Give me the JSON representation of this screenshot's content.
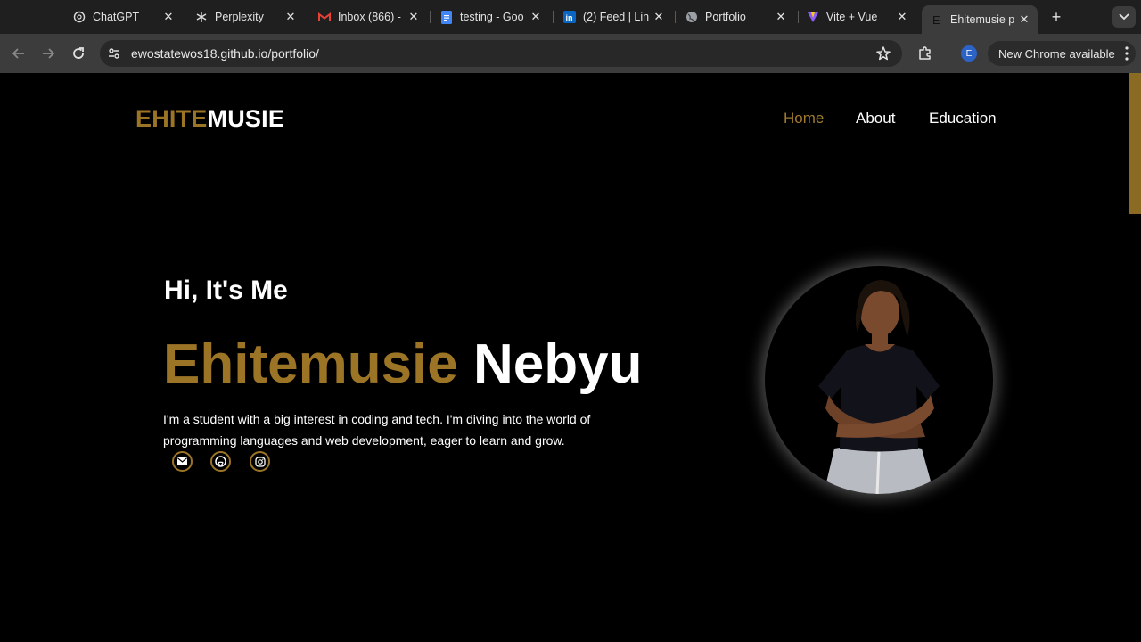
{
  "browser": {
    "tabs": [
      {
        "title": "ChatGPT",
        "icon": "chatgpt-icon"
      },
      {
        "title": "Perplexity",
        "icon": "perplexity-icon"
      },
      {
        "title": "Inbox (866) -",
        "icon": "gmail-icon"
      },
      {
        "title": "testing - Goo",
        "icon": "google-docs-icon"
      },
      {
        "title": "(2) Feed | Lin",
        "icon": "linkedin-icon"
      },
      {
        "title": "Portfolio",
        "icon": "globe-icon"
      },
      {
        "title": "Vite + Vue",
        "icon": "vite-icon"
      },
      {
        "title": "Ehitemusie p",
        "icon": "site-favicon-icon",
        "active": true
      }
    ],
    "url": "ewostatewos18.github.io/portfolio/",
    "profile_initial": "E",
    "update_label": "New Chrome available"
  },
  "site": {
    "logo_part1": "EHITE",
    "logo_part2": "MUSIE",
    "nav": {
      "home": "Home",
      "about": "About",
      "education": "Education"
    },
    "greeting": "Hi, It's Me",
    "first_name": "Ehitemusie",
    "last_name": "Nebyu",
    "bio": "I'm a student with a big interest in coding and tech. I'm diving into the world of programming languages and web development, eager to learn and grow.",
    "social": [
      "mail-icon",
      "github-icon",
      "instagram-icon"
    ]
  },
  "colors": {
    "accent": "#9c7426",
    "background": "#000000",
    "text": "#ffffff"
  }
}
